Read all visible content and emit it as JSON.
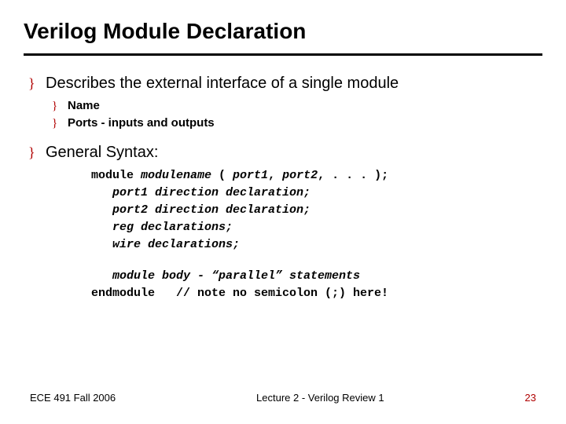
{
  "title": "Verilog Module Declaration",
  "bullets": {
    "b1": "Describes the external interface of a single module",
    "b1_sub": {
      "s1": "Name",
      "s2": "Ports - inputs and outputs"
    },
    "b2": "General Syntax:"
  },
  "code": {
    "l1a": "module ",
    "l1b": "modulename",
    "l1c": " ( ",
    "l1d": "port1",
    "l1e": ", ",
    "l1f": "port2",
    "l1g": ", . . . );",
    "l2a": "   port1 direction declaration;",
    "l3a": "   port2 direction declaration;",
    "l4a": "   reg declarations;",
    "l5a": "   wire declarations;",
    "l6a": "   module body - “parallel” statements",
    "l7a": "endmodule   // note no semicolon (;) here!"
  },
  "footer": {
    "left": "ECE 491 Fall 2006",
    "center": "Lecture 2 - Verilog Review 1",
    "right": "23"
  },
  "glyph": "}"
}
